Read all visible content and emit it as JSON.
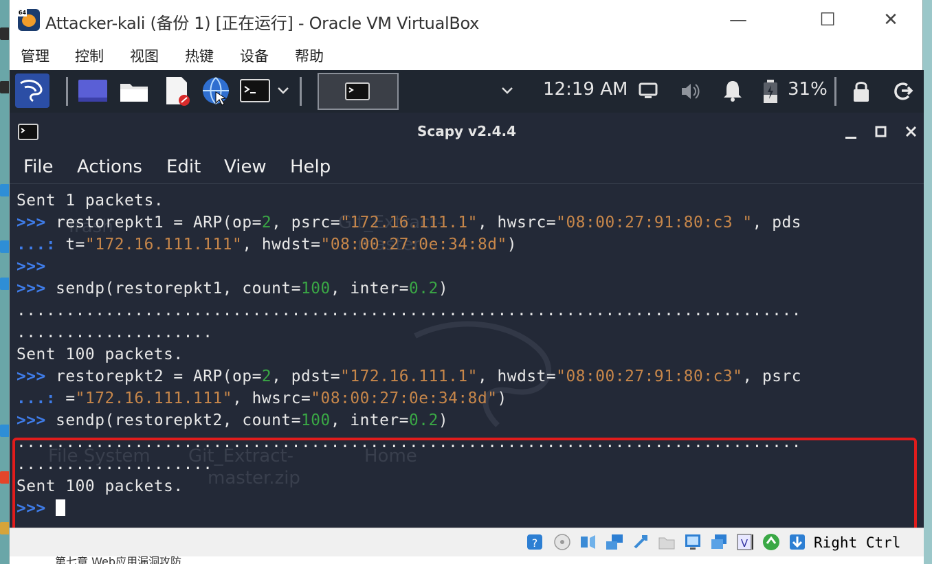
{
  "window": {
    "title": "Attacker-kali (备份 1) [正在运行] - Oracle VM VirtualBox",
    "minimize": "—",
    "maximize": "☐",
    "close": "✕"
  },
  "vbox_menu": [
    "管理",
    "控制",
    "视图",
    "热键",
    "设备",
    "帮助"
  ],
  "kali_panel": {
    "time": "12:19 AM",
    "battery": "31%"
  },
  "terminal": {
    "title": "Scapy v2.4.4",
    "menu": [
      "File",
      "Actions",
      "Edit",
      "View",
      "Help"
    ],
    "desktop_labels": {
      "trash": "Trash",
      "gitzip_top_a": "Git_Extract-",
      "gitzip_top_b": "master",
      "filesystem": "File System",
      "gitzip_a": "Git_Extract-",
      "gitzip_b": "master.zip",
      "home": "Home"
    },
    "lines": [
      {
        "parts": [
          {
            "t": "Sent 1 packets.",
            "c": "plain"
          }
        ]
      },
      {
        "parts": [
          {
            "t": ">>>",
            "c": "pr"
          },
          {
            "t": " restorepkt1 = ARP(op=",
            "c": "plain"
          },
          {
            "t": "2",
            "c": "num"
          },
          {
            "t": ", psrc=",
            "c": "plain"
          },
          {
            "t": "\"172.16.111.1\"",
            "c": "str"
          },
          {
            "t": ", hwsrc=",
            "c": "plain"
          },
          {
            "t": "\"08:00:27:91:80:c3 \"",
            "c": "str"
          },
          {
            "t": ", pds",
            "c": "plain"
          }
        ]
      },
      {
        "parts": [
          {
            "t": "...:",
            "c": "pr"
          },
          {
            "t": " t=",
            "c": "plain"
          },
          {
            "t": "\"172.16.111.111\"",
            "c": "str"
          },
          {
            "t": ", hwdst=",
            "c": "plain"
          },
          {
            "t": "\"08:00:27:0e:34:8d\"",
            "c": "str"
          },
          {
            "t": ")",
            "c": "plain"
          }
        ]
      },
      {
        "parts": [
          {
            "t": ">>>",
            "c": "pr"
          }
        ]
      },
      {
        "parts": [
          {
            "t": ">>>",
            "c": "pr"
          },
          {
            "t": " sendp(restorepkt1, count=",
            "c": "plain"
          },
          {
            "t": "100",
            "c": "num"
          },
          {
            "t": ", inter=",
            "c": "plain"
          },
          {
            "t": "0.2",
            "c": "num"
          },
          {
            "t": ")",
            "c": "plain"
          }
        ]
      },
      {
        "parts": [
          {
            "t": "................................................................................",
            "c": "plain"
          }
        ]
      },
      {
        "parts": [
          {
            "t": "....................",
            "c": "plain"
          }
        ]
      },
      {
        "parts": [
          {
            "t": "Sent 100 packets.",
            "c": "plain"
          }
        ]
      },
      {
        "parts": [
          {
            "t": ">>>",
            "c": "pr"
          },
          {
            "t": " restorepkt2 = ARP(op=",
            "c": "plain"
          },
          {
            "t": "2",
            "c": "num"
          },
          {
            "t": ", pdst=",
            "c": "plain"
          },
          {
            "t": "\"172.16.111.1\"",
            "c": "str"
          },
          {
            "t": ", hwdst=",
            "c": "plain"
          },
          {
            "t": "\"08:00:27:91:80:c3\"",
            "c": "str"
          },
          {
            "t": ", psrc",
            "c": "plain"
          }
        ]
      },
      {
        "parts": [
          {
            "t": "...:",
            "c": "pr"
          },
          {
            "t": " =",
            "c": "plain"
          },
          {
            "t": "\"172.16.111.111\"",
            "c": "str"
          },
          {
            "t": ", hwsrc=",
            "c": "plain"
          },
          {
            "t": "\"08:00:27:0e:34:8d\"",
            "c": "str"
          },
          {
            "t": ")",
            "c": "plain"
          }
        ]
      },
      {
        "parts": [
          {
            "t": ">>>",
            "c": "pr"
          },
          {
            "t": " sendp(restorepkt2, count=",
            "c": "plain"
          },
          {
            "t": "100",
            "c": "num"
          },
          {
            "t": ", inter=",
            "c": "plain"
          },
          {
            "t": "0.2",
            "c": "num"
          },
          {
            "t": ")",
            "c": "plain"
          }
        ]
      },
      {
        "parts": [
          {
            "t": "................................................................................",
            "c": "plain"
          }
        ]
      },
      {
        "parts": [
          {
            "t": "....................",
            "c": "plain"
          }
        ]
      },
      {
        "parts": [
          {
            "t": "Sent 100 packets.",
            "c": "plain"
          }
        ]
      },
      {
        "parts": [
          {
            "t": ">>>",
            "c": "pr"
          },
          {
            "t": " ",
            "c": "plain"
          }
        ],
        "cursor": true
      }
    ]
  },
  "status_bar": {
    "host_key": "Right Ctrl"
  },
  "colors": {
    "terminal_bg": "#232937",
    "prompt": "#3f7ce8",
    "string": "#c8874a",
    "number": "#3aa845",
    "highlight_box": "#e01c1c"
  },
  "behind_text": "第七章 Web应用漏洞攻防"
}
